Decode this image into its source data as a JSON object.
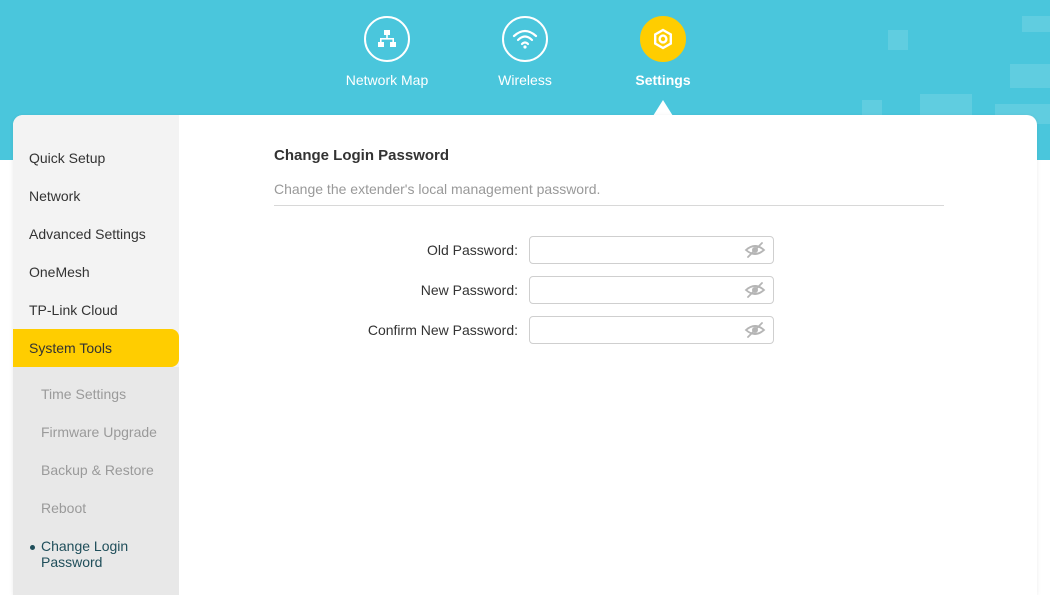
{
  "header": {
    "nav": [
      {
        "label": "Network Map",
        "icon": "network-map-icon",
        "active": false
      },
      {
        "label": "Wireless",
        "icon": "wifi-icon",
        "active": false
      },
      {
        "label": "Settings",
        "icon": "settings-gear-icon",
        "active": true
      }
    ]
  },
  "sidebar": {
    "items": [
      {
        "label": "Quick Setup"
      },
      {
        "label": "Network"
      },
      {
        "label": "Advanced Settings"
      },
      {
        "label": "OneMesh"
      },
      {
        "label": "TP-Link Cloud"
      },
      {
        "label": "System Tools",
        "active": true
      }
    ],
    "sub_items": [
      {
        "label": "Time Settings"
      },
      {
        "label": "Firmware Upgrade"
      },
      {
        "label": "Backup & Restore"
      },
      {
        "label": "Reboot"
      },
      {
        "label": "Change Login Password",
        "current": true
      }
    ]
  },
  "main": {
    "title": "Change Login Password",
    "description": "Change the extender's local management password.",
    "fields": [
      {
        "label": "Old Password:",
        "value": ""
      },
      {
        "label": "New Password:",
        "value": ""
      },
      {
        "label": "Confirm New Password:",
        "value": ""
      }
    ]
  },
  "colors": {
    "header_bg": "#4ac6dc",
    "accent": "#ffcd00",
    "sidebar_bg": "#f3f3f3",
    "submenu_bg": "#e8e8e8"
  }
}
